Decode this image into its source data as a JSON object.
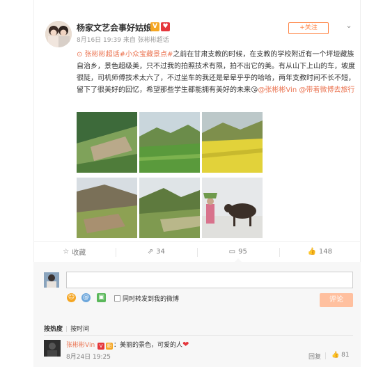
{
  "post": {
    "author": "杨家文艺会事好姑娘",
    "vip_badge": "V",
    "meta": "8月16日 19:39 来自 张彬彬超话",
    "follow_label": "+关注",
    "chevron": "⌄",
    "topic_pin": "⊙",
    "topic_link": "张彬彬超话#小众宝藏景点#",
    "text_1": "之前在甘肃支教的时候，在支教的学校附近有一个坪垭藏族自治乡，景色超级美，只不过我的拍照技术有限，拍不出它的美。有从山下上山的车，坡度很陡，司机师傅技术太六了，不过坐车的我还是晕晕乎乎的哈哈，两年支教时间不长不短，留下了很美好的回忆，希望那些学生都能拥有美好的未来",
    "emoji": "😘",
    "mention_1": "@张彬彬Vin",
    "mention_2": "@带着微博去旅行"
  },
  "photos": [
    {
      "name": "photo-1",
      "colors": [
        "#3d6a3a",
        "#7fa25a",
        "#b9a98a"
      ]
    },
    {
      "name": "photo-2",
      "colors": [
        "#c9d6dc",
        "#6b8c4a",
        "#5a9a3c"
      ]
    },
    {
      "name": "photo-3",
      "colors": [
        "#bcc8c9",
        "#7e8f4c",
        "#e2d23a"
      ]
    },
    {
      "name": "photo-4",
      "colors": [
        "#d7dde2",
        "#7a7058",
        "#8da153"
      ]
    },
    {
      "name": "photo-5",
      "colors": [
        "#dfe4e7",
        "#5e7a3e",
        "#b9b78a"
      ]
    },
    {
      "name": "photo-6",
      "colors": [
        "#e6e8ea",
        "#e0e0dd",
        "#3b2f28"
      ]
    }
  ],
  "actions": {
    "favorite": {
      "icon": "☆",
      "label": "收藏"
    },
    "repost": {
      "icon": "⇗",
      "label": "34"
    },
    "comment": {
      "icon": "▭",
      "label": "95"
    },
    "like": {
      "icon": "👍",
      "label": "148"
    }
  },
  "composer": {
    "placeholder": "",
    "emoji_icon": "☺",
    "at_icon": "@",
    "image_icon": "▣",
    "repost_label": "同时转发到我的微博",
    "submit_label": "评论"
  },
  "sort": {
    "hot": "按热度",
    "separator": "|",
    "time": "按时间"
  },
  "comment": {
    "name": "张彬彬Vin",
    "badge_v": "V",
    "badge_fan": "粉",
    "text": "：美丽的景色，可爱的人",
    "heart": "❤",
    "time": "8月24日 19:25",
    "reply_label": "回复",
    "like_icon": "👍",
    "like_count": "81"
  },
  "colors": {
    "accent": "#eb7350",
    "follow": "#ff8140",
    "submit": "#ffc09f"
  }
}
